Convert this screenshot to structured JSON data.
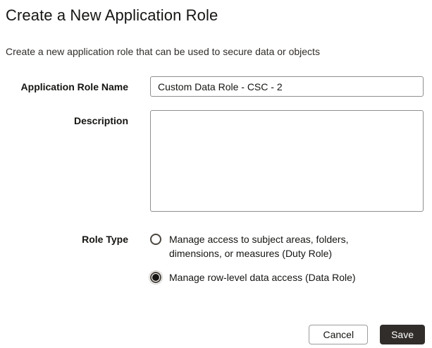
{
  "dialog": {
    "title": "Create a New Application Role",
    "subtitle": "Create a new application role that can be used to secure data or objects",
    "fields": {
      "role_name": {
        "label": "Application Role Name",
        "value": "Custom Data Role - CSC - 2"
      },
      "description": {
        "label": "Description",
        "value": ""
      },
      "role_type": {
        "label": "Role Type",
        "options": [
          {
            "label": "Manage access to subject areas, folders, dimensions, or measures (Duty Role)",
            "selected": false
          },
          {
            "label": "Manage row-level data access (Data Role)",
            "selected": true
          }
        ]
      }
    },
    "buttons": {
      "cancel": "Cancel",
      "save": "Save"
    },
    "colors": {
      "text": "#161513",
      "input_border": "#8f8f8f",
      "save_button_bg": "#312d2a",
      "save_button_text": "#ffffff"
    }
  }
}
